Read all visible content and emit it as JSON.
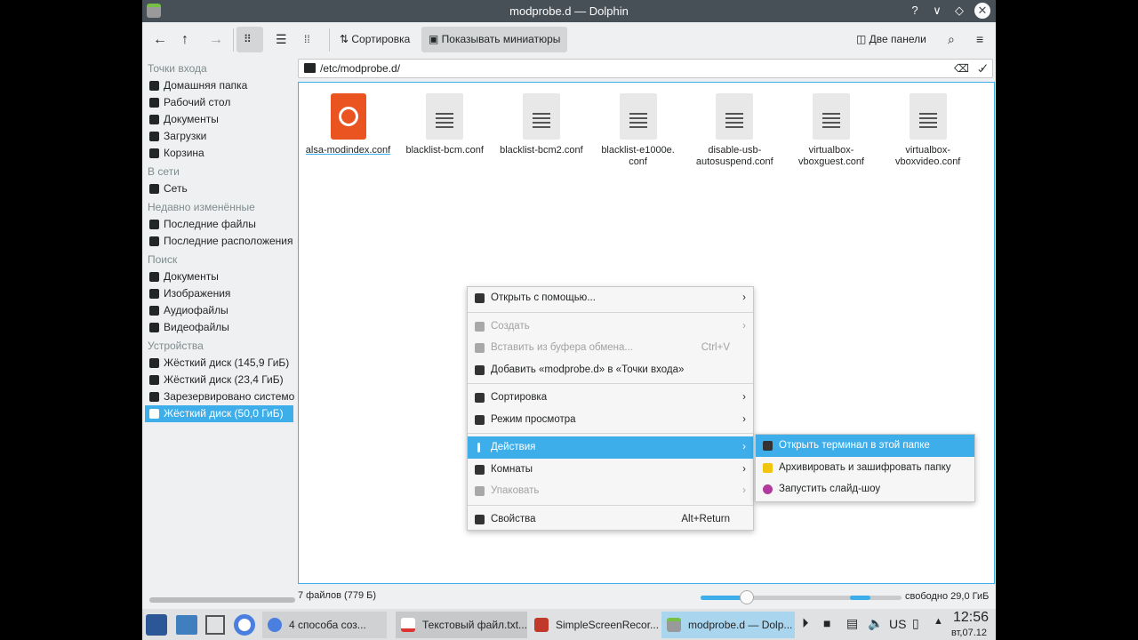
{
  "window": {
    "title": "modprobe.d — Dolphin",
    "buttons": [
      "?",
      "∨",
      "◇",
      "✕"
    ]
  },
  "toolbar": {
    "sort": "Сортировка",
    "thumbnails": "Показывать миниатюры",
    "split": "Две панели"
  },
  "location": {
    "path": "/etc/modprobe.d/"
  },
  "sidebar": {
    "sections": [
      {
        "title": "Точки входа",
        "items": [
          "Домашняя папка",
          "Рабочий стол",
          "Документы",
          "Загрузки",
          "Корзина"
        ]
      },
      {
        "title": "В сети",
        "items": [
          "Сеть"
        ]
      },
      {
        "title": "Недавно изменённые",
        "items": [
          "Последние файлы",
          "Последние расположения"
        ]
      },
      {
        "title": "Поиск",
        "items": [
          "Документы",
          "Изображения",
          "Аудиофайлы",
          "Видеофайлы"
        ]
      },
      {
        "title": "Устройства",
        "items": [
          "Жёсткий диск (145,9 ГиБ)",
          "Жёсткий диск (23,4 ГиБ)",
          "Зарезервировано системой",
          "Жёсткий диск (50,0 ГиБ)"
        ]
      }
    ],
    "selected": "Жёсткий диск (50,0 ГиБ)"
  },
  "files": [
    {
      "name": "alsa-modindex.conf",
      "icon": "ubuntu-config-icon"
    },
    {
      "name": "blacklist-bcm.conf"
    },
    {
      "name": "blacklist-bcm2.conf"
    },
    {
      "name": "blacklist-e1000e.\nconf"
    },
    {
      "name": "disable-usb-\nautosuspend.conf"
    },
    {
      "name": "virtualbox-\nvboxguest.conf"
    },
    {
      "name": "virtualbox-\nvboxvideo.conf"
    }
  ],
  "status": {
    "count": "7 файлов (779 Б)",
    "free": "свободно 29,0 ГиБ",
    "zoom_fraction": 0.3,
    "disk_used_fraction": 0.4
  },
  "context_menu": {
    "items": [
      {
        "label": "Открыть с помощью...",
        "submenu": true
      },
      {
        "label": "Создать",
        "submenu": true,
        "disabled": true
      },
      {
        "label": "Вставить из буфера обмена...",
        "shortcut": "Ctrl+V",
        "disabled": true
      },
      {
        "label": "Добавить «modprobe.d» в «Точки входа»"
      },
      {
        "label": "Сортировка",
        "submenu": true
      },
      {
        "label": "Режим просмотра",
        "submenu": true
      },
      {
        "label": "Действия",
        "submenu": true,
        "highlighted": true
      },
      {
        "label": "Комнаты",
        "submenu": true
      },
      {
        "label": "Упаковать",
        "submenu": true,
        "disabled": true
      },
      {
        "label": "Свойства",
        "shortcut": "Alt+Return"
      }
    ]
  },
  "submenu": {
    "items": [
      "Открыть терминал в этой папке",
      "Архивировать и зашифровать папку",
      "Запустить слайд-шоу"
    ]
  },
  "taskbar": {
    "tasks": [
      "4 способа соз...",
      "Текстовый файл.txt...",
      "SimpleScreenRecor...",
      "modprobe.d — Dolp..."
    ],
    "layout": "US",
    "time": "12:56",
    "date": "вт,07.12"
  },
  "colors": {
    "accent": "#3daee9",
    "titlebar": "#475057"
  }
}
